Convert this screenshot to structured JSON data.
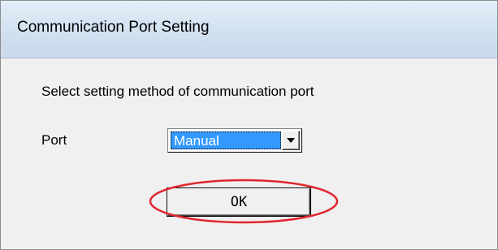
{
  "window": {
    "title": "Communication Port Setting"
  },
  "dialog": {
    "instruction": "Select setting method of communication port",
    "port_label": "Port",
    "port_select": {
      "value": "Manual"
    },
    "ok_label": "OK"
  },
  "colors": {
    "selection": "#3399ff",
    "annotation": "#e0262f",
    "dialog_background": "#f0f0f0"
  }
}
